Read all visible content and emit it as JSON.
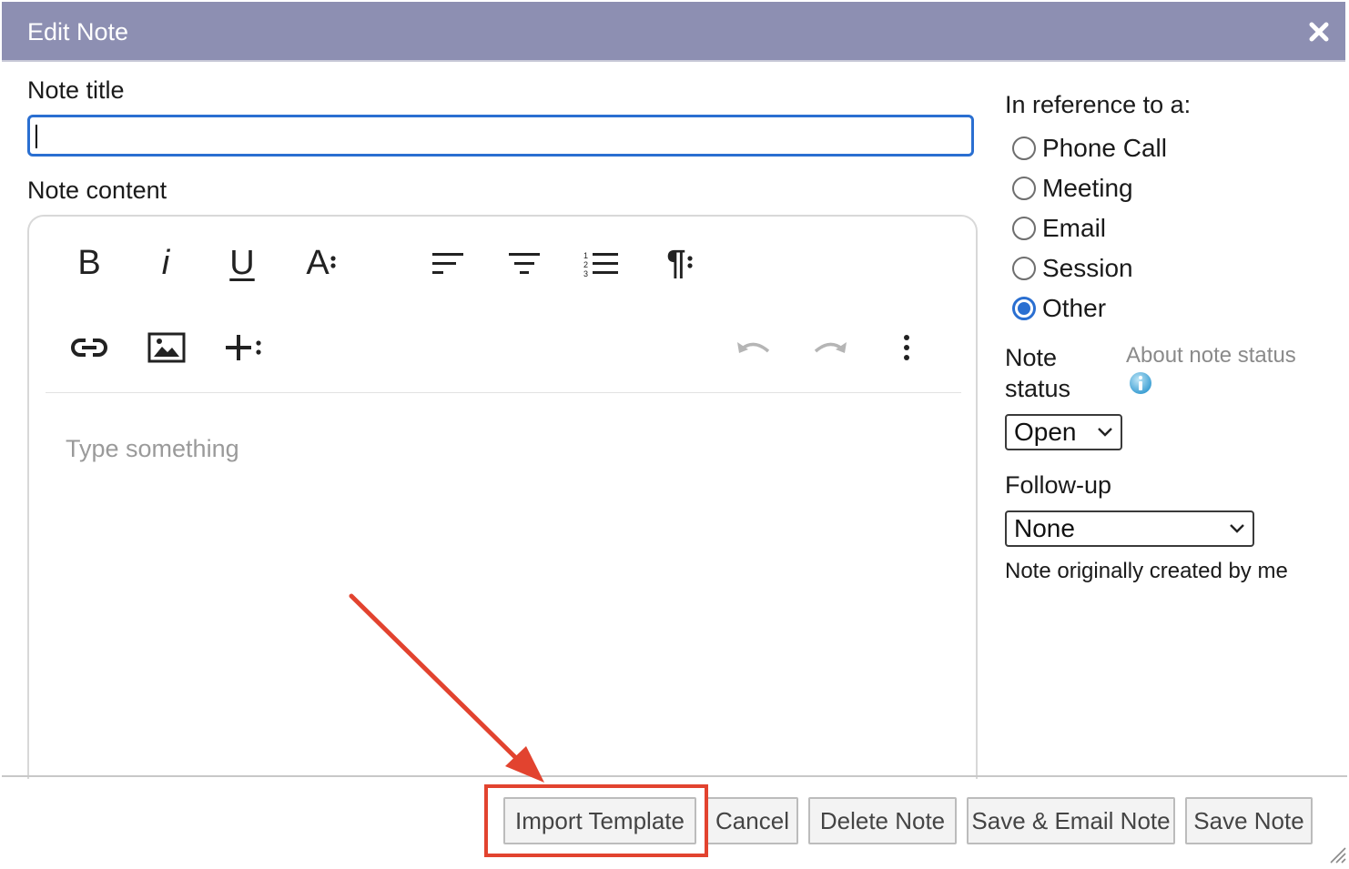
{
  "dialog": {
    "title": "Edit Note"
  },
  "form": {
    "note_title_label": "Note title",
    "note_title_value": "",
    "note_content_label": "Note content",
    "editor_placeholder": "Type something"
  },
  "toolbar": {
    "row1": [
      {
        "name": "bold-button",
        "icon": "bold-icon",
        "text": "B"
      },
      {
        "name": "italic-button",
        "icon": "italic-icon",
        "text": "i"
      },
      {
        "name": "underline-button",
        "icon": "underline-icon",
        "text": "U"
      },
      {
        "name": "font-size-button",
        "icon": "font-size-icon",
        "text": "A"
      },
      {
        "name": "align-left-button",
        "icon": "align-left-icon"
      },
      {
        "name": "align-center-button",
        "icon": "align-center-icon"
      },
      {
        "name": "ordered-list-button",
        "icon": "ordered-list-icon"
      },
      {
        "name": "paragraph-button",
        "icon": "paragraph-icon",
        "text": "¶"
      }
    ],
    "row2": [
      {
        "name": "link-button",
        "icon": "link-icon"
      },
      {
        "name": "image-button",
        "icon": "image-icon"
      },
      {
        "name": "insert-button",
        "icon": "plus-icon"
      },
      {
        "name": "undo-button",
        "icon": "undo-icon"
      },
      {
        "name": "redo-button",
        "icon": "redo-icon"
      },
      {
        "name": "more-button",
        "icon": "more-vertical-icon"
      }
    ]
  },
  "reference": {
    "label": "In reference to a:",
    "options": [
      {
        "label": "Phone Call",
        "checked": false
      },
      {
        "label": "Meeting",
        "checked": false
      },
      {
        "label": "Email",
        "checked": false
      },
      {
        "label": "Session",
        "checked": false
      },
      {
        "label": "Other",
        "checked": true
      }
    ]
  },
  "status": {
    "label_line1": "Note",
    "label_line2": "status",
    "about_link": "About note status",
    "info_icon": "info-icon",
    "selected": "Open"
  },
  "followup": {
    "label": "Follow-up",
    "selected": "None"
  },
  "created_by_text": "Note originally created by me",
  "buttons": {
    "import_template": "Import Template",
    "cancel": "Cancel",
    "delete_note": "Delete Note",
    "save_email_note": "Save & Email Note",
    "save_note": "Save Note"
  },
  "colors": {
    "title_bar": "#8d8fb2",
    "focus_blue": "#2a6fd1",
    "highlight_red": "#e2432f"
  }
}
